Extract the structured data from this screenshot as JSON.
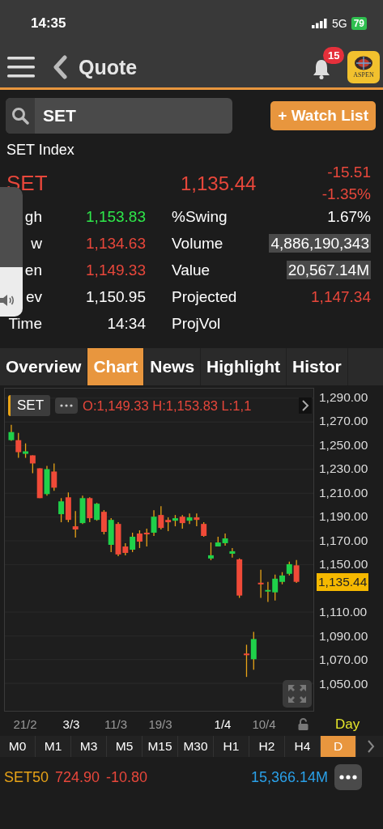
{
  "status_bar": {
    "time": "14:35",
    "network": "5G",
    "battery": "79"
  },
  "header": {
    "title": "Quote",
    "notification_count": "15",
    "logo_text": "ASPEN"
  },
  "search": {
    "value": "SET",
    "watch_button": "+ Watch List"
  },
  "quote": {
    "name": "SET Index",
    "symbol": "SET",
    "last": "1,135.44",
    "change": "-15.51",
    "change_pct": "-1.35%",
    "rows": [
      {
        "left": {
          "label": "gh",
          "value": "1,153.83",
          "color": "#2ee84a"
        },
        "right": {
          "label": "%Swing",
          "value": "1.67%",
          "negative": false,
          "boxed": false
        }
      },
      {
        "left": {
          "label": "w",
          "value": "1,134.63",
          "color": "#e8473b"
        },
        "right": {
          "label": "Volume",
          "value": "4,886,190,343",
          "negative": false,
          "boxed": true
        }
      },
      {
        "left": {
          "label": "en",
          "value": "1,149.33",
          "color": "#e8473b"
        },
        "right": {
          "label": "Value",
          "value": "20,567.14M",
          "negative": false,
          "boxed": true
        }
      },
      {
        "left": {
          "label": "ev",
          "value": "1,150.95",
          "color": "#ffffff"
        },
        "right": {
          "label": "Projected",
          "value": "1,147.34",
          "negative": true,
          "boxed": false
        }
      },
      {
        "left": {
          "label": "Time",
          "value": "14:34",
          "color": "#ffffff"
        },
        "right": {
          "label": "ProjVol"
        }
      }
    ]
  },
  "volume_overlay": {
    "level": 0.38
  },
  "tabs": [
    {
      "label": "Overview",
      "selected": false
    },
    {
      "label": "Chart",
      "selected": true
    },
    {
      "label": "News",
      "selected": false
    },
    {
      "label": "Highlight",
      "selected": false
    },
    {
      "label": "Histor",
      "selected": false
    }
  ],
  "chart": {
    "symbol": "SET",
    "ohlc": "O:1,149.33 H:1,153.83 L:1,1",
    "last_price": "1,135.44",
    "period": "Day",
    "x_labels": [
      {
        "label": "21/2",
        "bright": false
      },
      {
        "label": "3/3",
        "bright": true
      },
      {
        "label": "11/3",
        "bright": false
      },
      {
        "label": "19/3",
        "bright": false
      },
      {
        "label": "1/4",
        "bright": true
      },
      {
        "label": "10/4",
        "bright": false
      }
    ],
    "chart_data": {
      "type": "candlestick",
      "categories": [
        null,
        null,
        null,
        null,
        null,
        null,
        null,
        null,
        null,
        null,
        null,
        null,
        null,
        null,
        null,
        null,
        null,
        null,
        null,
        null,
        null,
        null,
        null,
        null,
        null,
        null,
        null,
        null,
        null,
        null,
        null,
        null,
        null,
        null,
        null,
        null,
        null,
        null,
        null,
        null,
        null
      ],
      "ohlc": [
        [
          1254.7,
          1267.6,
          1254.1,
          1261.5
        ],
        [
          1254.7,
          1260.8,
          1239.8,
          1244.6
        ],
        [
          1243.2,
          1252.0,
          1239.8,
          1245.3
        ],
        [
          1241.9,
          1241.9,
          1226.9,
          1235.1
        ],
        [
          1231.0,
          1231.0,
          1205.9,
          1205.9
        ],
        [
          1209.3,
          1233.0,
          1208.0,
          1230.3
        ],
        [
          1228.3,
          1235.1,
          1212.0,
          1214.7
        ],
        [
          1192.4,
          1205.9,
          1185.6,
          1203.2
        ],
        [
          1206.6,
          1210.7,
          1185.6,
          1187.6
        ],
        [
          1182.2,
          1195.1,
          1172.7,
          1179.5
        ],
        [
          1184.9,
          1208.0,
          1184.2,
          1205.9
        ],
        [
          1205.9,
          1206.6,
          1185.6,
          1189.0
        ],
        [
          1187.6,
          1201.9,
          1186.9,
          1201.2
        ],
        [
          1194.4,
          1195.8,
          1175.4,
          1177.5
        ],
        [
          1166.6,
          1189.0,
          1160.5,
          1187.6
        ],
        [
          1184.2,
          1185.6,
          1157.1,
          1158.5
        ],
        [
          1165.2,
          1168.0,
          1157.8,
          1159.8
        ],
        [
          1162.5,
          1176.8,
          1160.5,
          1173.4
        ],
        [
          1176.1,
          1178.8,
          1163.9,
          1169.3
        ],
        [
          1176.8,
          1180.2,
          1165.2,
          1175.4
        ],
        [
          1176.8,
          1195.8,
          1174.1,
          1190.3
        ],
        [
          1191.7,
          1199.1,
          1179.5,
          1180.8
        ],
        [
          1187.6,
          1189.7,
          1178.1,
          1185.6
        ],
        [
          1186.9,
          1191.7,
          1182.2,
          1189.0
        ],
        [
          1190.3,
          1191.7,
          1180.2,
          1184.9
        ],
        [
          1186.9,
          1193.0,
          1184.2,
          1189.7
        ],
        [
          1189.7,
          1193.0,
          1182.2,
          1187.6
        ],
        [
          1184.2,
          1185.6,
          1173.4,
          1174.1
        ],
        [
          1155.1,
          1168.6,
          1153.7,
          1157.8
        ],
        [
          1165.2,
          1173.4,
          1165.2,
          1168.6
        ],
        [
          1168.0,
          1176.1,
          1165.9,
          1172.0
        ],
        [
          1159.1,
          1163.9,
          1155.8,
          1161.2
        ],
        [
          1154.4,
          1155.1,
          1121.9,
          1123.9
        ],
        [
          1075.1,
          1082.5,
          1055.4,
          1073.7
        ],
        [
          1070.3,
          1093.4,
          1061.5,
          1087.3
        ],
        [
          1134.7,
          1145.6,
          1121.9,
          1133.4
        ],
        [
          1127.3,
          1135.4,
          1118.5,
          1128.6
        ],
        [
          1126.6,
          1141.5,
          1119.8,
          1138.1
        ],
        [
          1135.4,
          1143.6,
          1133.4,
          1140.8
        ],
        [
          1142.2,
          1152.4,
          1140.8,
          1150.3
        ],
        [
          1149.33,
          1153.83,
          1134.63,
          1135.44
        ]
      ],
      "ylim": [
        1026.9,
        1298.1
      ],
      "grid": true,
      "yticks": [
        {
          "value": 1290,
          "label": "1,290.00"
        },
        {
          "value": 1270,
          "label": "1,270.00"
        },
        {
          "value": 1250,
          "label": "1,250.00"
        },
        {
          "value": 1230,
          "label": "1,230.00"
        },
        {
          "value": 1210,
          "label": "1,210.00"
        },
        {
          "value": 1190,
          "label": "1,190.00"
        },
        {
          "value": 1170,
          "label": "1,170.00"
        },
        {
          "value": 1150,
          "label": "1,150.00"
        },
        {
          "value": 1110,
          "label": "1,110.00"
        },
        {
          "value": 1090,
          "label": "1,090.00"
        },
        {
          "value": 1070,
          "label": "1,070.00"
        },
        {
          "value": 1050,
          "label": "1,050.00"
        }
      ]
    }
  },
  "timeframes": [
    {
      "label": "M0",
      "selected": false
    },
    {
      "label": "M1",
      "selected": false
    },
    {
      "label": "M3",
      "selected": false
    },
    {
      "label": "M5",
      "selected": false
    },
    {
      "label": "M15",
      "selected": false
    },
    {
      "label": "M30",
      "selected": false
    },
    {
      "label": "H1",
      "selected": false
    },
    {
      "label": "H2",
      "selected": false
    },
    {
      "label": "H4",
      "selected": false
    },
    {
      "label": "D",
      "selected": true
    }
  ],
  "ticker": {
    "symbol": "SET50",
    "price": "724.90",
    "change": "-10.80",
    "value": "15,366.14M"
  }
}
